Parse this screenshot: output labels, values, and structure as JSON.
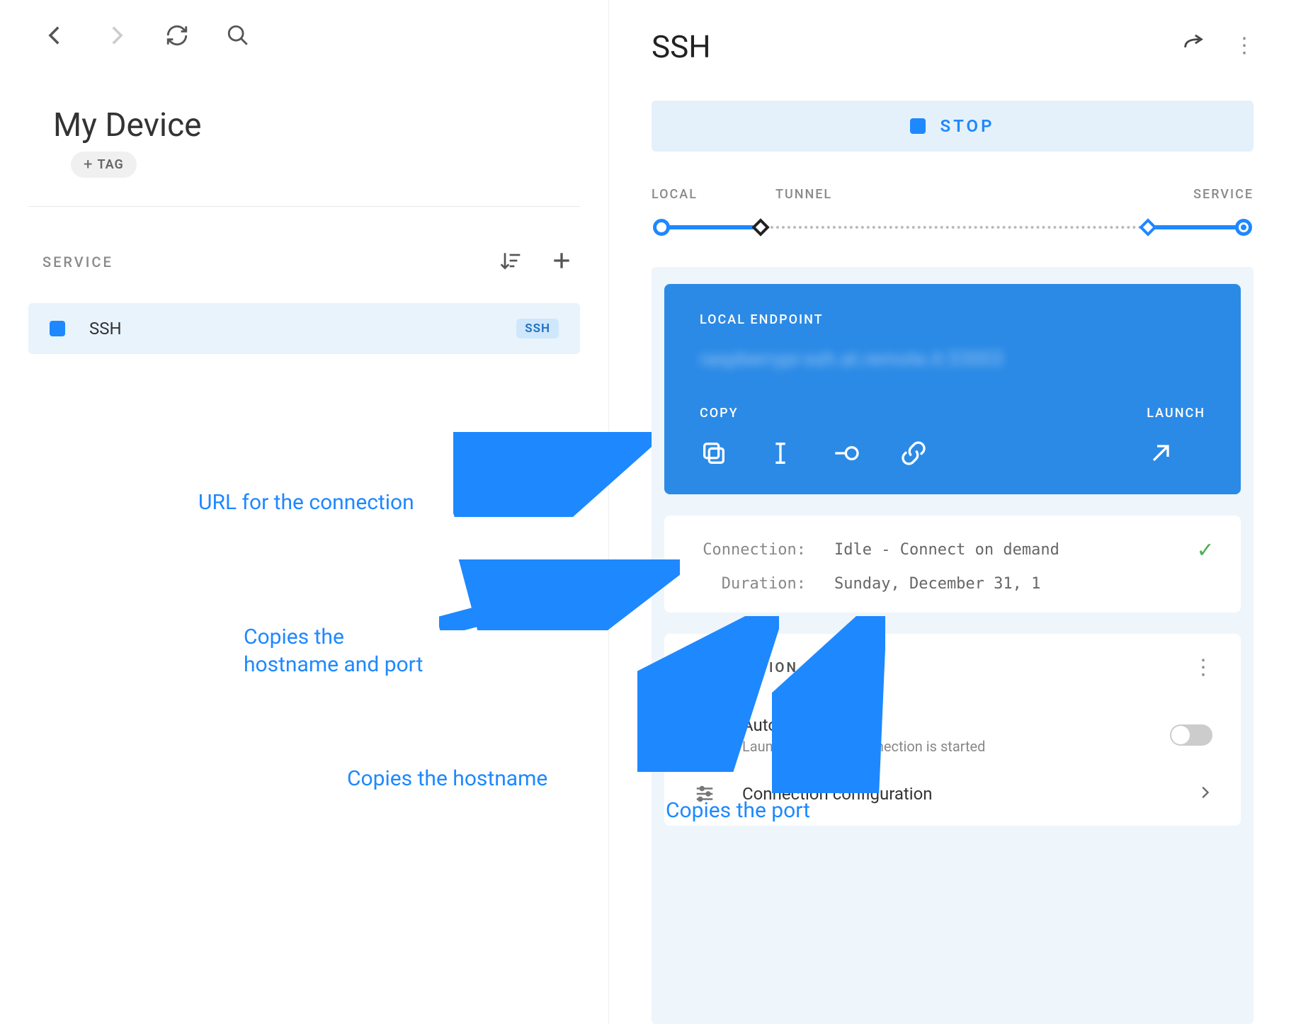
{
  "left": {
    "device_title": "My Device",
    "tag_label": "TAG",
    "service_header": "SERVICE",
    "service_row": {
      "name": "SSH",
      "badge": "SSH"
    }
  },
  "right": {
    "title": "SSH",
    "stop_label": "STOP",
    "pipe": {
      "local": "LOCAL",
      "tunnel": "TUNNEL",
      "service": "SERVICE"
    },
    "endpoint": {
      "label": "LOCAL ENDPOINT",
      "url": "raspberrypi-ssh.at.remote.it:33003",
      "copy_label": "COPY",
      "launch_label": "LAUNCH"
    },
    "status": {
      "connection_key": "Connection:",
      "connection_val": "Idle - Connect on demand",
      "duration_key": "Duration:",
      "duration_val": "Sunday, December 31, 1"
    },
    "connection": {
      "header": "CONNECTION",
      "auto_launch_title": "Auto Launch",
      "auto_launch_sub": "Launch when the connection is started",
      "config_title": "Connection configuration"
    }
  },
  "annotations": {
    "url": "URL for the connection",
    "hostport": "Copies the\nhostname and port",
    "hostname": "Copies the hostname",
    "port": "Copies the port"
  }
}
